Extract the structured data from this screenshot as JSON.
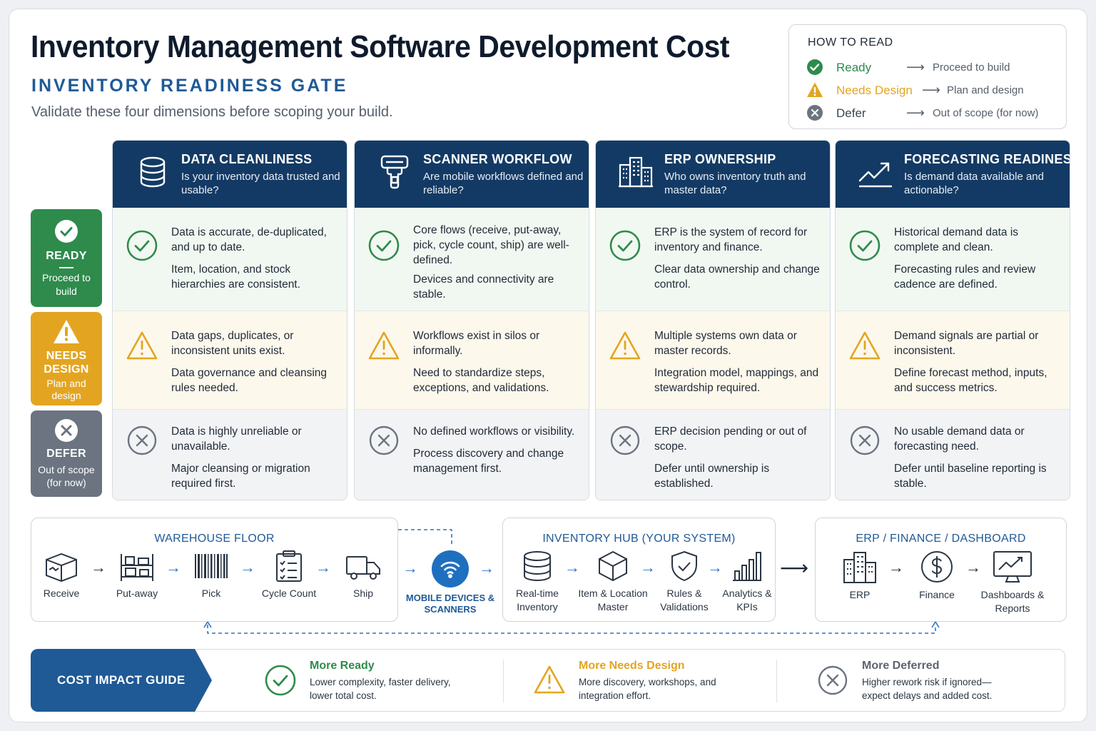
{
  "header": {
    "title": "Inventory Management Software Development Cost",
    "subtitle": "INVENTORY READINESS GATE",
    "tagline": "Validate these four dimensions before scoping your build."
  },
  "legend": {
    "title": "HOW TO READ",
    "rows": [
      {
        "label": "Ready",
        "desc": "Proceed to build",
        "color": "#2e8b4c",
        "icon": "check-circle-icon"
      },
      {
        "label": "Needs Design",
        "desc": "Plan and design",
        "color": "#e3a521",
        "icon": "warning-triangle-icon"
      },
      {
        "label": "Defer",
        "desc": "Out of scope (for now)",
        "color": "#5c6470",
        "icon": "x-circle-icon"
      }
    ]
  },
  "sidebar": {
    "ready": {
      "label": "READY",
      "desc": "Proceed to build"
    },
    "needs": {
      "label": "NEEDS DESIGN",
      "desc": "Plan and design"
    },
    "defer": {
      "label": "DEFER",
      "desc": "Out of scope (for now)"
    }
  },
  "dimensions": [
    {
      "title": "DATA CLEANLINESS",
      "question": "Is your inventory data trusted and usable?",
      "icon": "database-icon",
      "ready": [
        "Data is accurate, de-duplicated, and up to date.",
        "Item, location, and stock hierarchies are consistent."
      ],
      "needs": [
        "Data gaps, duplicates, or inconsistent units exist.",
        "Data governance and cleansing rules needed."
      ],
      "defer": [
        "Data is highly unreliable or unavailable.",
        "Major cleansing or migration required first."
      ]
    },
    {
      "title": "SCANNER WORKFLOW",
      "question": "Are mobile workflows defined and reliable?",
      "icon": "scanner-icon",
      "ready": [
        "Core flows (receive, put-away, pick, cycle count, ship) are well-defined.",
        "Devices and connectivity are stable."
      ],
      "needs": [
        "Workflows exist in silos or informally.",
        "Need to standardize steps, exceptions, and validations."
      ],
      "defer": [
        "No defined workflows or visibility.",
        "Process discovery and change management first."
      ]
    },
    {
      "title": "ERP OWNERSHIP",
      "question": "Who owns inventory truth and master data?",
      "icon": "building-icon",
      "ready": [
        "ERP is the system of record for inventory and finance.",
        "Clear data ownership and change control."
      ],
      "needs": [
        "Multiple systems own data or master records.",
        "Integration model, mappings, and stewardship required."
      ],
      "defer": [
        "ERP decision pending or out of scope.",
        "Defer until ownership is established."
      ]
    },
    {
      "title": "FORECASTING READINESS",
      "question": "Is demand data available and actionable?",
      "icon": "trend-chart-icon",
      "ready": [
        "Historical demand data is complete and clean.",
        "Forecasting rules and review cadence are defined."
      ],
      "needs": [
        "Demand signals are partial or inconsistent.",
        "Define forecast method, inputs, and success metrics."
      ],
      "defer": [
        "No usable demand data or forecasting need.",
        "Defer until baseline reporting is stable."
      ]
    }
  ],
  "flow": {
    "warehouse": {
      "title": "WAREHOUSE FLOOR",
      "steps": [
        "Receive",
        "Put-away",
        "Pick",
        "Cycle Count",
        "Ship"
      ]
    },
    "mobile": {
      "label": "MOBILE DEVICES & SCANNERS"
    },
    "hub": {
      "title": "INVENTORY HUB (YOUR SYSTEM)",
      "steps": [
        "Real-time Inventory",
        "Item & Location Master",
        "Rules & Validations",
        "Analytics & KPIs"
      ]
    },
    "erp": {
      "title": "ERP / FINANCE / DASHBOARD",
      "steps": [
        "ERP",
        "Finance",
        "Dashboards & Reports"
      ]
    }
  },
  "cost": {
    "tag": "COST IMPACT GUIDE",
    "items": [
      {
        "title": "More Ready",
        "desc": "Lower complexity, faster delivery, lower total cost.",
        "color": "#2e8b4c"
      },
      {
        "title": "More Needs Design",
        "desc": "More discovery, workshops, and integration effort.",
        "color": "#e3a521"
      },
      {
        "title": "More Deferred",
        "desc": "Higher rework risk if ignored—expect delays and added cost.",
        "color": "#5c6470"
      }
    ]
  }
}
